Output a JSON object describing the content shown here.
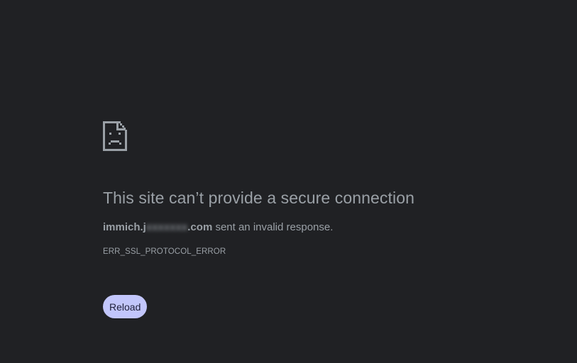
{
  "error_page": {
    "icon": "sad-page-icon",
    "title": "This site can’t provide a secure connection",
    "host_prefix": "immich.j",
    "host_redacted": "xxxxxxx",
    "host_suffix": ".com",
    "message_rest": " sent an invalid response.",
    "error_code": "ERR_SSL_PROTOCOL_ERROR",
    "reload_label": "Reload"
  },
  "colors": {
    "background": "#202124",
    "text": "#9aa0a6",
    "button_bg": "#c2c6fb",
    "button_text": "#1f1f3a"
  }
}
